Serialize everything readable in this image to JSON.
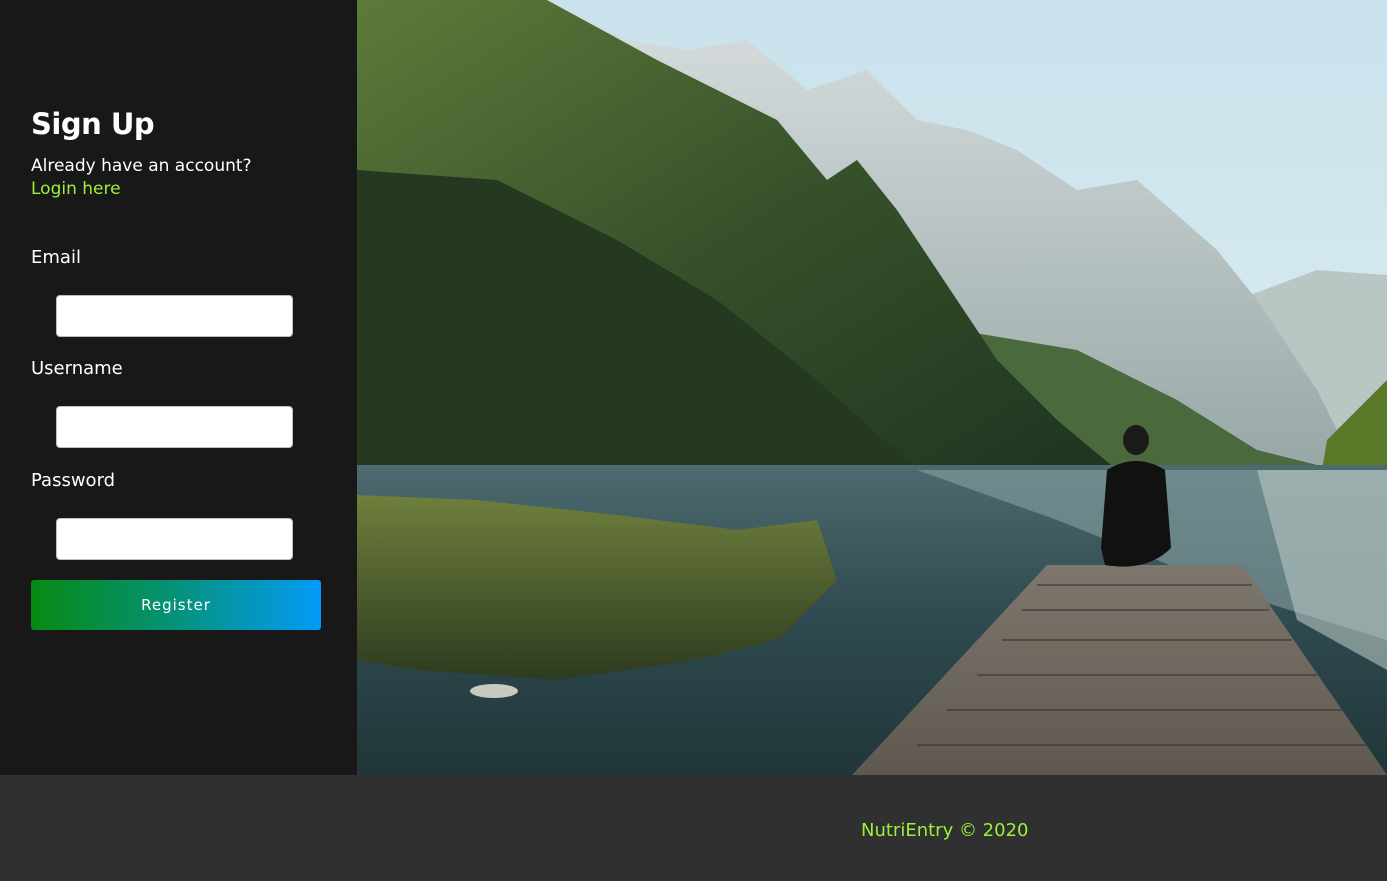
{
  "signup": {
    "title": "Sign Up",
    "have_account": "Already have an account?",
    "login_link": "Login here"
  },
  "form": {
    "email_label": "Email",
    "email_value": "",
    "username_label": "Username",
    "username_value": "",
    "password_label": "Password",
    "password_value": "",
    "register_label": "Register"
  },
  "hero": {
    "image": "mountain-lake-with-person-on-dock"
  },
  "footer": {
    "text": "NutriEntry © 2020"
  },
  "colors": {
    "sidebar_bg": "#181818",
    "footer_bg": "#303030",
    "accent": "#9cf03a",
    "button_gradient_start": "#078a12",
    "button_gradient_end": "#039bf8"
  }
}
